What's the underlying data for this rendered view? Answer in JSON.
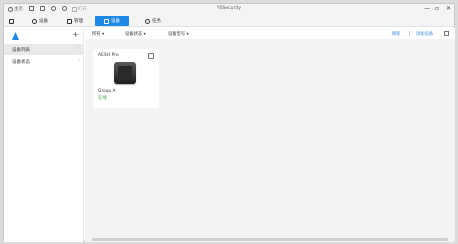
{
  "titlebar": {
    "items": [
      {
        "icon": "power-icon",
        "label": "主页"
      },
      {
        "icon": "grid-icon",
        "label": ""
      },
      {
        "icon": "save-icon",
        "label": ""
      },
      {
        "icon": "undo-icon",
        "label": ""
      },
      {
        "icon": "redo-icon",
        "label": ""
      },
      {
        "icon": "folder-icon",
        "label": "打开"
      }
    ],
    "app_title": "YSSecurity",
    "controls": {
      "minimize": "—",
      "maximize": "▫",
      "close": "✕"
    }
  },
  "tabs": [
    {
      "icon": "home-icon",
      "label": ""
    },
    {
      "icon": "settings-icon",
      "label": "设备"
    },
    {
      "icon": "apps-icon",
      "label": "管理"
    },
    {
      "icon": "device-icon",
      "label": "设备",
      "active": true
    },
    {
      "icon": "clock-icon",
      "label": "任务"
    }
  ],
  "sidebar": {
    "logo_icon": "app-logo-icon",
    "add_label": "+",
    "items": [
      {
        "label": "设备列表",
        "selected": true
      },
      {
        "label": "设备状态",
        "selected": false
      }
    ]
  },
  "toolbar": {
    "filters": [
      "所有 ▾",
      "设备状态 ▾",
      "设备型号 ▾"
    ],
    "links": [
      "刷新",
      "添加设备"
    ],
    "settings_icon": "grid-view-icon"
  },
  "device_card": {
    "title": "AESH Pro",
    "group": "Group A",
    "status": "在线",
    "status_color": "#43a047"
  }
}
